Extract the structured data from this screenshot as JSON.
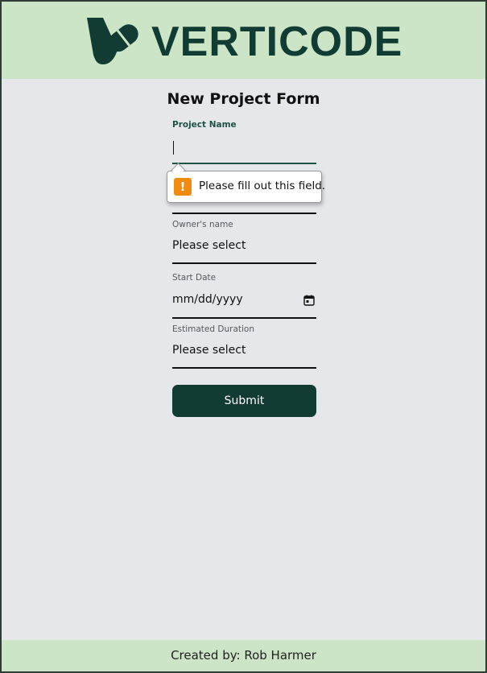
{
  "header": {
    "brand": "VERTICODE",
    "brand_color": "#113c33",
    "background": "#cbe5c6"
  },
  "form": {
    "title": "New Project Form",
    "project_name": {
      "label": "Project Name",
      "value": ""
    },
    "owner_name": {
      "label": "Owner's name",
      "selected": "Please select"
    },
    "start_date": {
      "label": "Start Date",
      "placeholder": "mm/dd/yyyy",
      "icon": "calendar-icon"
    },
    "estimated_duration": {
      "label": "Estimated Duration",
      "selected": "Please select"
    },
    "submit_label": "Submit"
  },
  "validation": {
    "message": "Please fill out this field.",
    "icon": "warning-icon",
    "icon_color": "#f28a0f"
  },
  "footer": {
    "text": "Created by: Rob Harmer"
  }
}
